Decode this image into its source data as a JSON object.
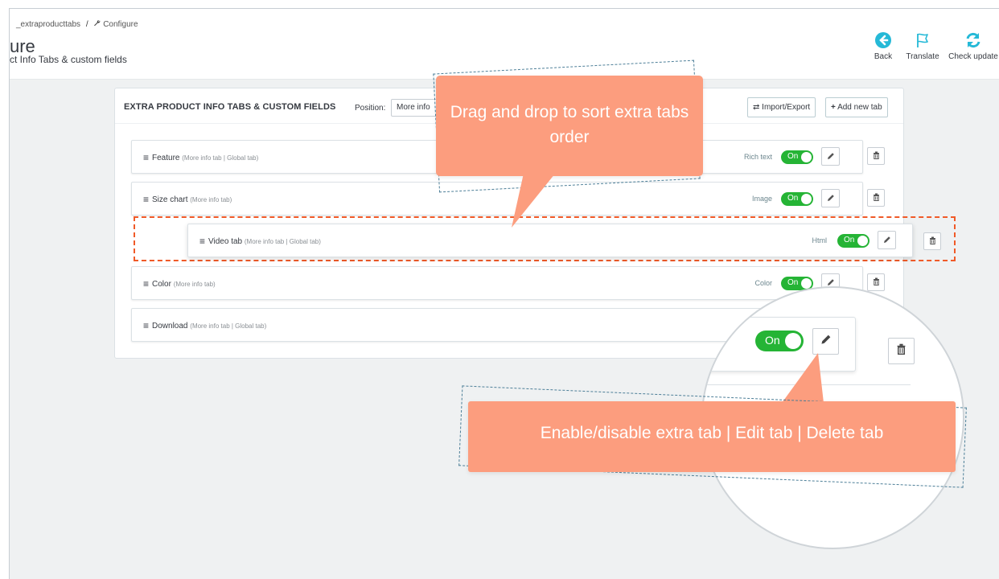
{
  "breadcrumb": {
    "module": "_extraproducttabs",
    "separator": "/",
    "current": "Configure"
  },
  "page": {
    "title": "ure",
    "subtitle": "ct Info Tabs & custom fields"
  },
  "toolbar": [
    {
      "label": "Back",
      "icon": "back-arrow-icon"
    },
    {
      "label": "Translate",
      "icon": "flag-icon"
    },
    {
      "label": "Check update",
      "icon": "refresh-icon"
    }
  ],
  "panel": {
    "title": "EXTRA PRODUCT INFO TABS & CUSTOM FIELDS",
    "position_label": "Position:",
    "position_value": "More info",
    "import_export": "Import/Export",
    "add_new_tab": "Add new tab"
  },
  "tabs": [
    {
      "name": "Feature",
      "meta": "(More info tab | Global tab)",
      "type": "Rich text",
      "toggle": "On"
    },
    {
      "name": "Size chart",
      "meta": "(More info tab)",
      "type": "Image",
      "toggle": "On"
    },
    {
      "name": "Video tab",
      "meta": "(More info tab | Global tab)",
      "type": "Html",
      "toggle": "On"
    },
    {
      "name": "Color",
      "meta": "(More info tab)",
      "type": "Color",
      "toggle": "On"
    },
    {
      "name": "Download",
      "meta": "(More info tab | Global tab)",
      "type": "",
      "toggle": "On"
    }
  ],
  "callouts": {
    "drag": "Drag and drop to sort extra tabs order",
    "actions": "Enable/disable extra tab | Edit tab | Delete tab"
  },
  "colors": {
    "accent_green": "#25b435",
    "callout": "#fc9d7e",
    "drag_highlight": "#f05a28",
    "back_blue": "#25b9d7"
  }
}
